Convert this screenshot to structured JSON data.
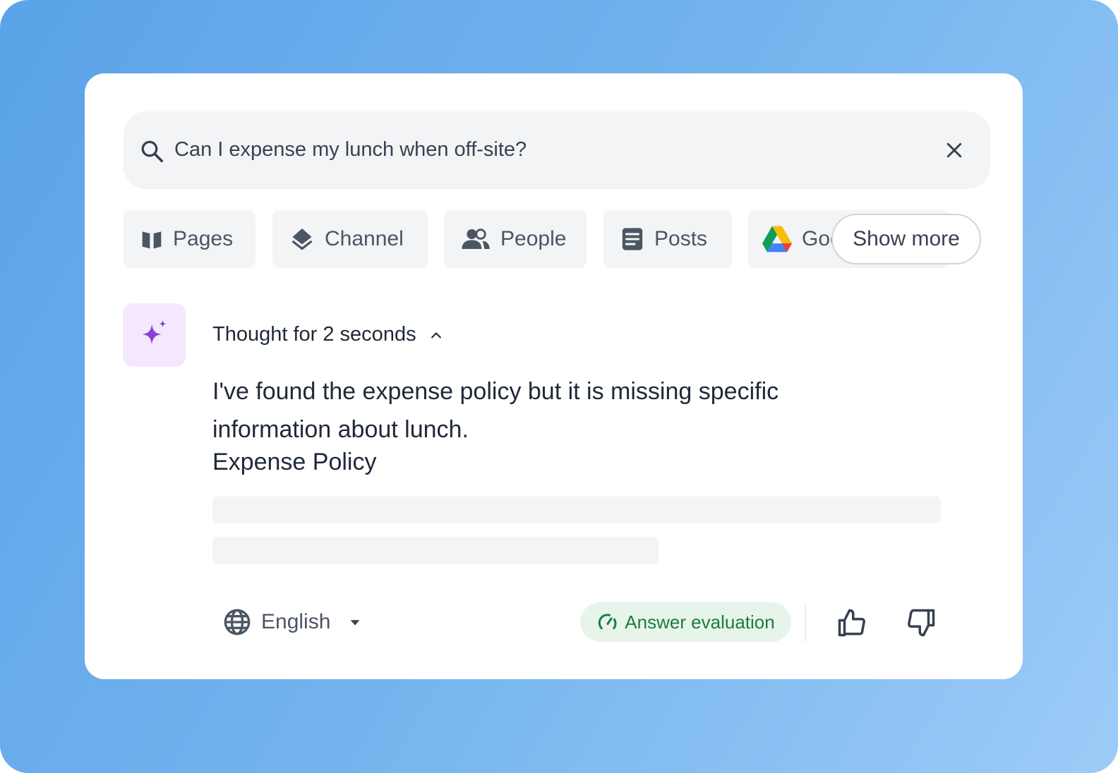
{
  "search": {
    "query": "Can I expense my lunch when off-site?",
    "search_icon": "search-icon",
    "clear_icon": "close-icon"
  },
  "filters": [
    {
      "label": "Pages",
      "icon": "book-icon"
    },
    {
      "label": "Channel",
      "icon": "layers-icon"
    },
    {
      "label": "People",
      "icon": "people-icon"
    },
    {
      "label": "Posts",
      "icon": "document-icon"
    },
    {
      "label": "Google Drive",
      "visible_label": "Goo",
      "icon": "google-drive-icon"
    }
  ],
  "show_more": "Show more",
  "answer": {
    "icon": "sparkle-icon",
    "thought": "Thought for 2 seconds",
    "text": "I've found the expense policy but it is missing specific information about lunch.",
    "source_title": "Expense Policy"
  },
  "footer": {
    "language": "English",
    "evaluation": "Answer evaluation"
  },
  "colors": {
    "accent_purple": "#8b3fd9",
    "eval_green": "#1e7a3f",
    "eval_bg": "#e6f4ea"
  }
}
